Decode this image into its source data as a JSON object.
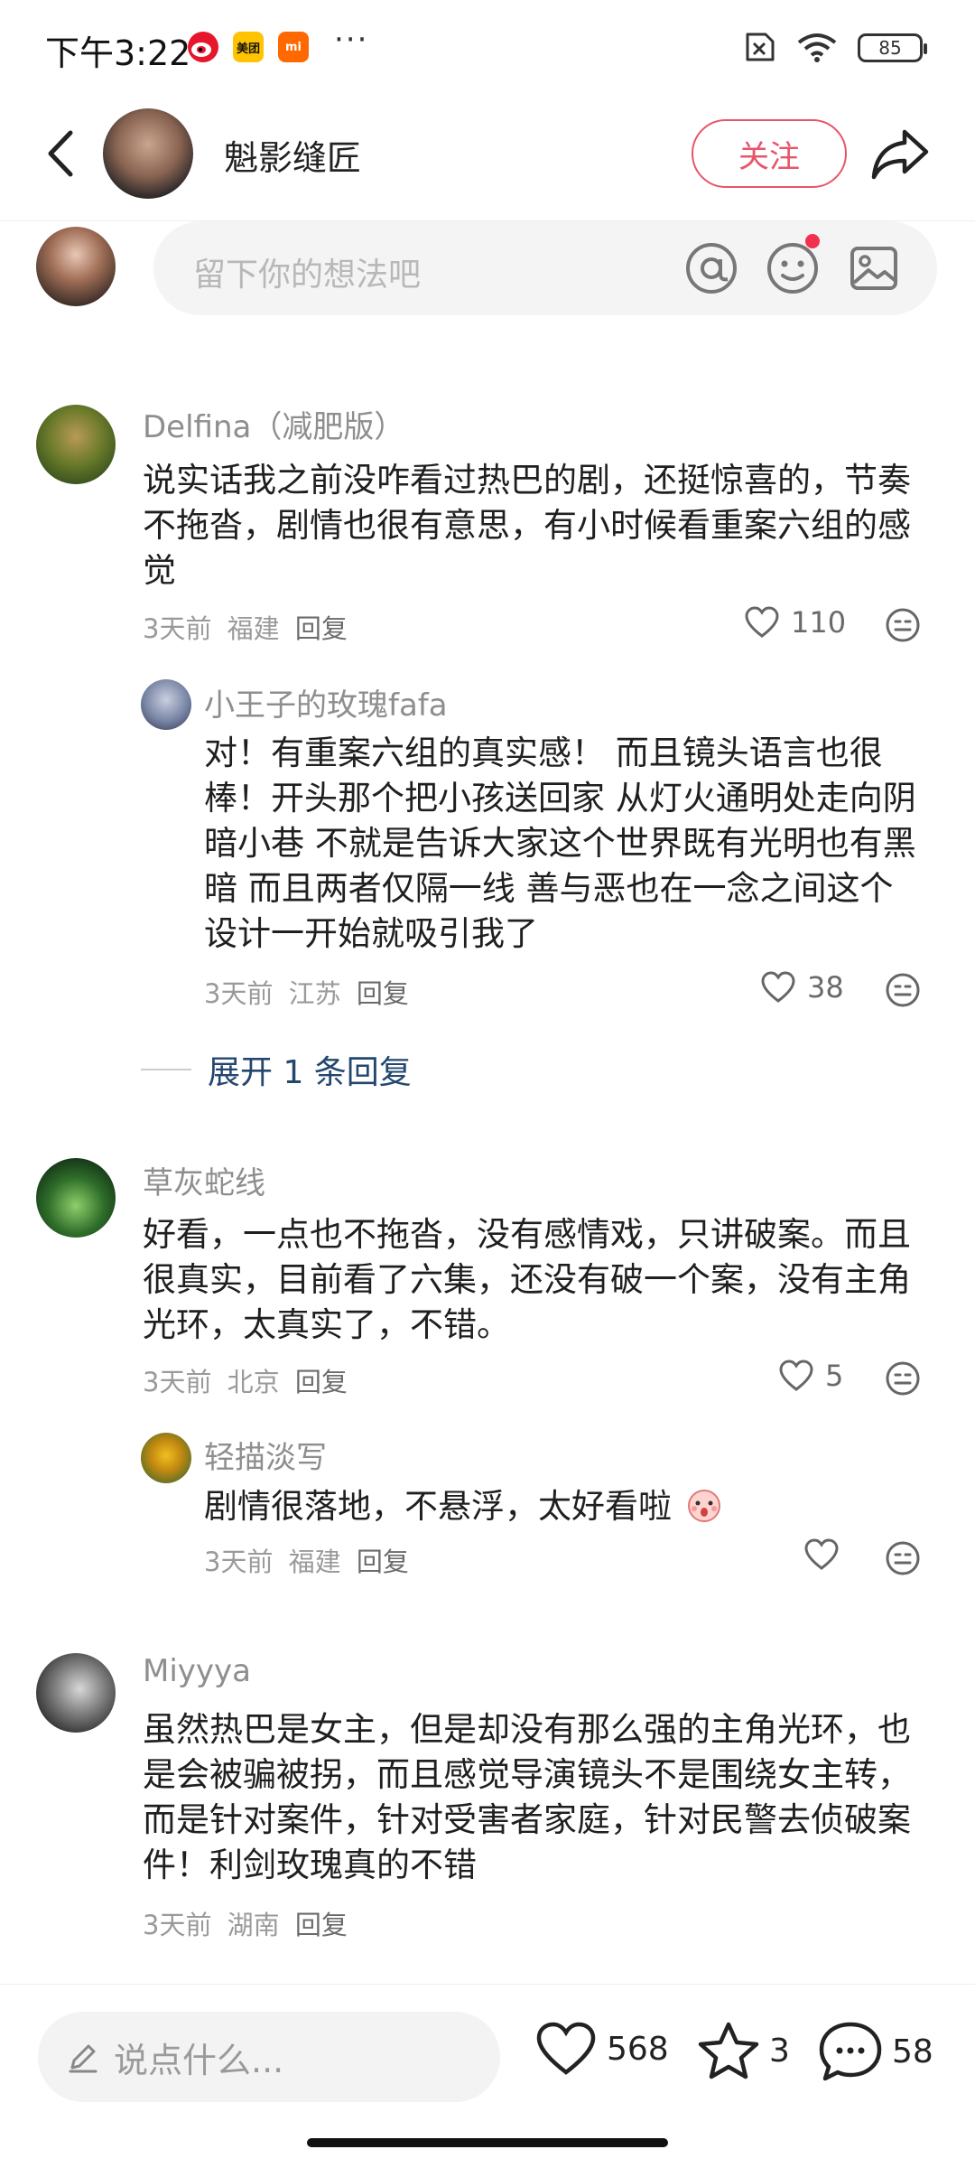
{
  "status_bar": {
    "time": "下午3:22",
    "apps": [
      {
        "name": "weibo-icon",
        "label": "微",
        "color": "#e6162d"
      },
      {
        "name": "meituan-icon",
        "label": "美团",
        "color": "#ffc300"
      },
      {
        "name": "xiaomi-icon",
        "label": "mi",
        "color": "#ff6900"
      }
    ],
    "more": "···",
    "battery": "85"
  },
  "header": {
    "title": "魁影缝匠",
    "follow_label": "关注"
  },
  "input": {
    "placeholder": "留下你的想法吧"
  },
  "comments": [
    {
      "name": "Delfina（减肥版）",
      "text": "说实话我之前没咋看过热巴的剧，还挺惊喜的，节奏不拖沓，剧情也很有意思，有小时候看重案六组的感觉",
      "time": "3天前",
      "location": "福建",
      "reply": "回复",
      "likes": "110",
      "replies": [
        {
          "name": "小王子的玫瑰fafa",
          "text": "对！有重案六组的真实感！ 而且镜头语言也很棒！开头那个把小孩送回家 从灯火通明处走向阴暗小巷 不就是告诉大家这个世界既有光明也有黑暗 而且两者仅隔一线 善与恶也在一念之间这个设计一开始就吸引我了",
          "time": "3天前",
          "location": "江苏",
          "reply": "回复",
          "likes": "38"
        }
      ],
      "expand": "展开 1 条回复"
    },
    {
      "name": "草灰蛇线",
      "text": "好看，一点也不拖沓，没有感情戏，只讲破案。而且很真实，目前看了六集，还没有破一个案，没有主角光环，太真实了，不错。",
      "time": "3天前",
      "location": "北京",
      "reply": "回复",
      "likes": "5",
      "replies": [
        {
          "name": "轻描淡写",
          "text": "剧情很落地，不悬浮，太好看啦",
          "time": "3天前",
          "location": "福建",
          "reply": "回复",
          "likes": ""
        }
      ]
    },
    {
      "name": "Miyyya",
      "text": "虽然热巴是女主，但是却没有那么强的主角光环，也是会被骗被拐，而且感觉导演镜头不是围绕女主转，而是针对案件，针对受害者家庭，针对民警去侦破案件！利剑玫瑰真的不错",
      "time": "3天前",
      "location": "湖南",
      "reply": "回复"
    }
  ],
  "bottom": {
    "placeholder": "说点什么...",
    "likes": "568",
    "stars": "3",
    "comments": "58"
  },
  "colors": {
    "accent": "#e9546b",
    "link": "#24476f"
  }
}
